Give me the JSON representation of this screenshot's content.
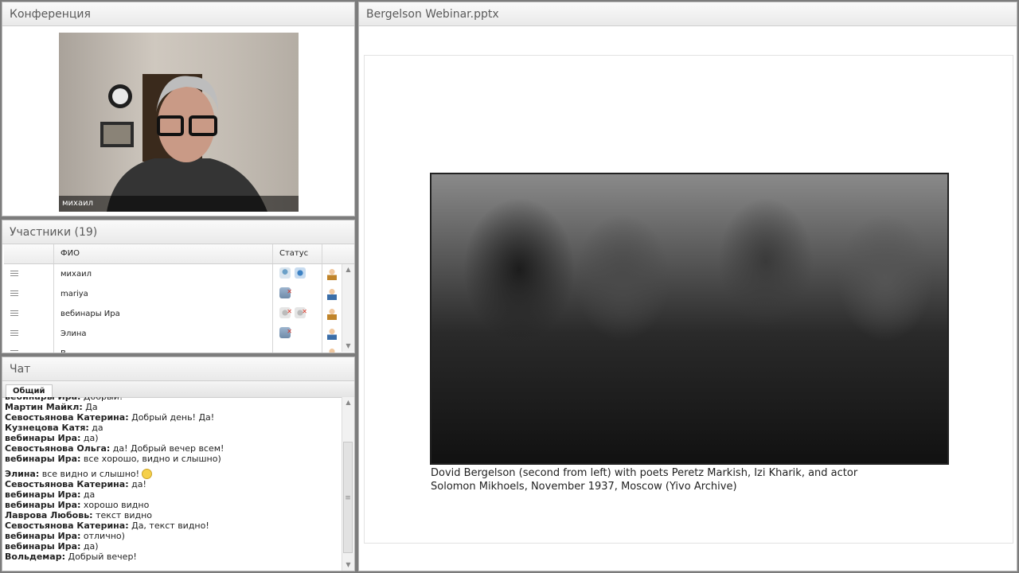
{
  "conference": {
    "title": "Конференция",
    "video_user": "михаил"
  },
  "participants": {
    "title": "Участники (19)",
    "col_name": "ФИО",
    "col_status": "Статус",
    "rows": [
      {
        "name": "михаил",
        "statuses": [
          "mic",
          "cam",
          "scr-x"
        ],
        "role": "mod"
      },
      {
        "name": "mariya",
        "statuses": [],
        "role": "user"
      },
      {
        "name": "вебинары Ира",
        "statuses": [
          "off",
          "off",
          "scr-x"
        ],
        "role": "mod"
      },
      {
        "name": "Элина",
        "statuses": [],
        "role": "user"
      },
      {
        "name": "В...",
        "statuses": [],
        "role": "mod"
      }
    ]
  },
  "chat": {
    "title": "Чат",
    "tab": "Общий",
    "messages": [
      {
        "author": "вебинары Ира:",
        "text": "Добрый!"
      },
      {
        "author": "Мартин Майкл:",
        "text": "Да"
      },
      {
        "author": "Севостьянова Катерина:",
        "text": "Добрый день! Да!"
      },
      {
        "author": "Кузнецова Катя:",
        "text": "да"
      },
      {
        "author": "вебинары Ира:",
        "text": "да)"
      },
      {
        "author": "Севостьянова Ольга:",
        "text": "да! Добрый вечер всем!"
      },
      {
        "author": "вебинары Ира:",
        "text": "все хорошо, видно и слышно)"
      },
      {
        "author": "Элина:",
        "text": "все видно и слышно!",
        "smile": true,
        "gap": true
      },
      {
        "author": "Севостьянова Катерина:",
        "text": "да!"
      },
      {
        "author": "вебинары Ира:",
        "text": "да"
      },
      {
        "author": "вебинары Ира:",
        "text": "хорошо видно"
      },
      {
        "author": "Лаврова Любовь:",
        "text": "текст видно"
      },
      {
        "author": "Севостьянова Катерина:",
        "text": "Да, текст видно!"
      },
      {
        "author": "вебинары Ира:",
        "text": "отлично)"
      },
      {
        "author": "вебинары Ира:",
        "text": "да)"
      },
      {
        "author": "Вольдемар:",
        "text": "Добрый вечер!"
      }
    ]
  },
  "presentation": {
    "title": "Bergelson Webinar.pptx",
    "caption_line1": "Dovid Bergelson (second from left) with poets Peretz Markish, Izi Kharik, and actor",
    "caption_line2": "Solomon Mikhoels, November 1937, Moscow   (Yivo Archive)"
  }
}
